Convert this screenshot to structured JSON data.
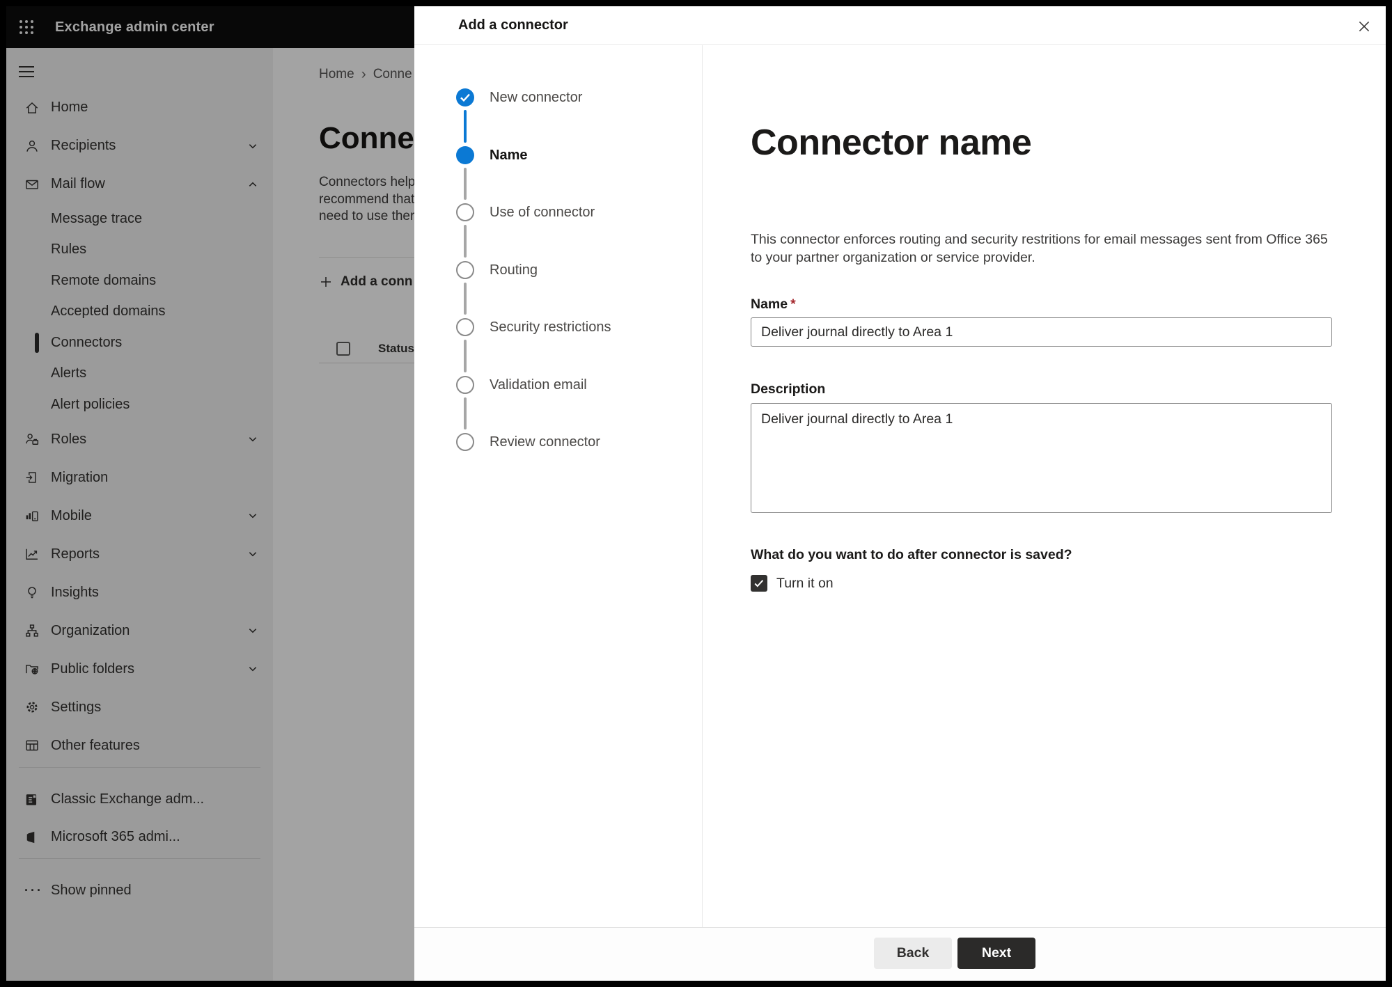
{
  "topbar": {
    "title": "Exchange admin center"
  },
  "sidebar": {
    "items": [
      {
        "label": "Home",
        "icon": "home-icon"
      },
      {
        "label": "Recipients",
        "icon": "person-icon",
        "chevron": "down"
      },
      {
        "label": "Mail flow",
        "icon": "mail-icon",
        "chevron": "up",
        "expanded": true
      },
      {
        "label": "Message trace",
        "type": "sub"
      },
      {
        "label": "Rules",
        "type": "sub"
      },
      {
        "label": "Remote domains",
        "type": "sub"
      },
      {
        "label": "Accepted domains",
        "type": "sub"
      },
      {
        "label": "Connectors",
        "type": "sub",
        "selected": true
      },
      {
        "label": "Alerts",
        "type": "sub"
      },
      {
        "label": "Alert policies",
        "type": "sub"
      },
      {
        "label": "Roles",
        "icon": "roles-icon",
        "chevron": "down"
      },
      {
        "label": "Migration",
        "icon": "migration-icon"
      },
      {
        "label": "Mobile",
        "icon": "mobile-icon",
        "chevron": "down"
      },
      {
        "label": "Reports",
        "icon": "reports-icon",
        "chevron": "down"
      },
      {
        "label": "Insights",
        "icon": "insights-icon"
      },
      {
        "label": "Organization",
        "icon": "organization-icon",
        "chevron": "down"
      },
      {
        "label": "Public folders",
        "icon": "public-folders-icon",
        "chevron": "down"
      },
      {
        "label": "Settings",
        "icon": "settings-icon"
      },
      {
        "label": "Other features",
        "icon": "other-features-icon"
      }
    ],
    "footer_items": [
      {
        "label": "Classic Exchange adm...",
        "icon": "classic-exchange-icon"
      },
      {
        "label": "Microsoft 365 admi...",
        "icon": "microsoft-365-icon"
      },
      {
        "label": "Show pinned",
        "icon": "ellipsis-icon"
      }
    ]
  },
  "page": {
    "breadcrumb": {
      "home": "Home",
      "separator": "›",
      "current": "Conne"
    },
    "title": "Connect",
    "intro_lines": [
      "Connectors help",
      "recommend that",
      "need to use ther"
    ],
    "toolbar": {
      "add_connector": "Add a conn"
    },
    "table": {
      "status_header": "Status"
    }
  },
  "modal": {
    "title": "Add a connector",
    "steps": [
      {
        "label": "New connector",
        "state": "done"
      },
      {
        "label": "Name",
        "state": "current"
      },
      {
        "label": "Use of connector",
        "state": "upcoming"
      },
      {
        "label": "Routing",
        "state": "upcoming"
      },
      {
        "label": "Security restrictions",
        "state": "upcoming"
      },
      {
        "label": "Validation email",
        "state": "upcoming"
      },
      {
        "label": "Review connector",
        "state": "upcoming"
      }
    ],
    "content": {
      "heading": "Connector name",
      "description": "This connector enforces routing and security restritions for email messages sent from Office 365 to your partner organization or service provider.",
      "name_label": "Name",
      "required_mark": "*",
      "name_value": "Deliver journal directly to Area 1",
      "description_label": "Description",
      "description_value": "Deliver journal directly to Area 1",
      "after_save_question": "What do you want to do after connector is saved?",
      "turn_on_label": "Turn it on",
      "turn_on_checked": true
    },
    "footer": {
      "back": "Back",
      "next": "Next"
    },
    "colors": {
      "accent": "#0b79d4",
      "primary_button": "#2b2a29"
    }
  }
}
